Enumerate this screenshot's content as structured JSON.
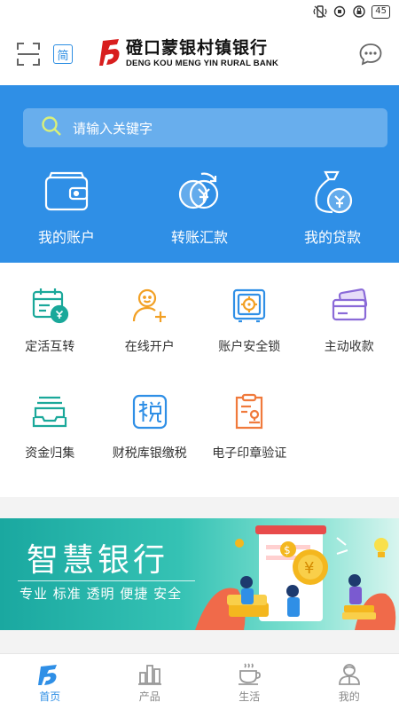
{
  "status_bar": {
    "battery": "45"
  },
  "header": {
    "simplified_label": "简",
    "bank_name_cn": "磴口蒙银村镇银行",
    "bank_name_en": "DENG KOU MENG YIN RURAL BANK"
  },
  "search": {
    "placeholder": "请输入关键字"
  },
  "quick_actions": [
    {
      "label": "我的账户",
      "icon": "wallet-icon"
    },
    {
      "label": "转账汇款",
      "icon": "transfer-icon"
    },
    {
      "label": "我的贷款",
      "icon": "loan-bag-icon"
    }
  ],
  "services": [
    {
      "label": "定活互转",
      "icon": "calendar-yuan-icon"
    },
    {
      "label": "在线开户",
      "icon": "add-user-icon"
    },
    {
      "label": "账户安全锁",
      "icon": "safe-icon"
    },
    {
      "label": "主动收款",
      "icon": "card-icon"
    },
    {
      "label": "资金归集",
      "icon": "tray-icon"
    },
    {
      "label": "财税库银缴税",
      "icon": "tax-icon"
    },
    {
      "label": "电子印章验证",
      "icon": "seal-icon"
    }
  ],
  "banner": {
    "title": "智慧银行",
    "tagline": "专业 标准 透明 便捷 安全"
  },
  "tabs": [
    {
      "label": "首页",
      "icon": "home-icon",
      "active": true
    },
    {
      "label": "产品",
      "icon": "product-chart-icon",
      "active": false
    },
    {
      "label": "生活",
      "icon": "cup-icon",
      "active": false
    },
    {
      "label": "我的",
      "icon": "profile-icon",
      "active": false
    }
  ],
  "colors": {
    "primary": "#2f8fe6",
    "service_teal": "#1aa89a",
    "service_orange": "#f2a024",
    "service_purple": "#8a6ad8"
  }
}
